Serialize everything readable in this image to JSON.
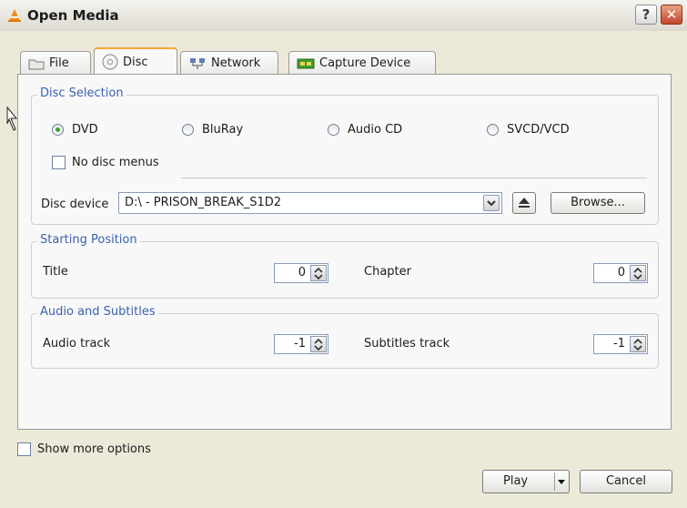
{
  "window": {
    "title": "Open Media",
    "help_label": "?",
    "close_label": "✕"
  },
  "tabs": [
    {
      "label": "File",
      "icon": "folder-icon"
    },
    {
      "label": "Disc",
      "icon": "disc-icon"
    },
    {
      "label": "Network",
      "icon": "network-icon"
    },
    {
      "label": "Capture Device",
      "icon": "capture-card-icon"
    }
  ],
  "disc_selection": {
    "title": "Disc Selection",
    "options": [
      {
        "label": "DVD",
        "checked": true
      },
      {
        "label": "BluRay",
        "checked": false
      },
      {
        "label": "Audio CD",
        "checked": false
      },
      {
        "label": "SVCD/VCD",
        "checked": false
      }
    ],
    "no_disc_menus": "No disc menus",
    "device_label": "Disc device",
    "device_value": "D:\\ - PRISON_BREAK_S1D2",
    "browse_label": "Browse..."
  },
  "starting_position": {
    "title": "Starting Position",
    "title_label": "Title",
    "title_value": "0",
    "chapter_label": "Chapter",
    "chapter_value": "0"
  },
  "audio_subtitles": {
    "title": "Audio and Subtitles",
    "audio_label": "Audio track",
    "audio_value": "-1",
    "subtitles_label": "Subtitles track",
    "subtitles_value": "-1"
  },
  "footer": {
    "show_more": "Show more options",
    "play_label": "Play",
    "cancel_label": "Cancel"
  },
  "colors": {
    "accent": "#f5a53a",
    "group_title": "#3a62b0",
    "radio_checked": "#3ea32d",
    "close": "#c6462b"
  }
}
